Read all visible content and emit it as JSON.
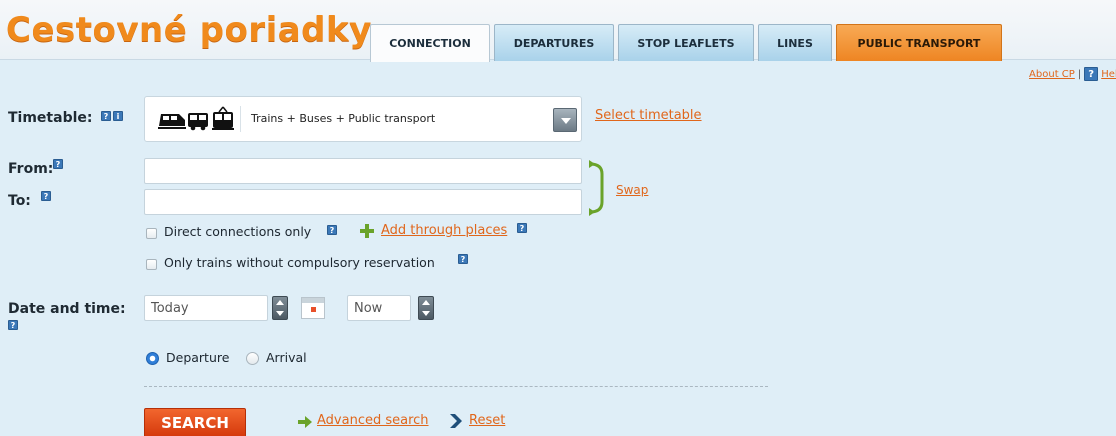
{
  "header": {
    "logo": "Cestovné poriadky",
    "tabs": [
      {
        "label": "CONNECTION",
        "state": "active"
      },
      {
        "label": "DEPARTURES",
        "state": "normal"
      },
      {
        "label": "STOP LEAFLETS",
        "state": "normal"
      },
      {
        "label": "LINES",
        "state": "normal"
      },
      {
        "label": "PUBLIC TRANSPORT",
        "state": "highlight"
      }
    ],
    "about_link": "About CP",
    "help_link": "Help"
  },
  "form": {
    "timetable": {
      "label": "Timetable:",
      "icons": [
        "train-icon",
        "bus-icon",
        "tram-icon"
      ],
      "value": "Trains + Buses + Public transport",
      "select_link": "Select timetable"
    },
    "from": {
      "label": "From:",
      "value": ""
    },
    "to": {
      "label": "To:",
      "value": ""
    },
    "swap_label": "Swap",
    "direct_connections_label": "Direct connections only",
    "add_through_places_label": "Add through places",
    "no_reservation_label": "Only trains without compulsory reservation",
    "datetime": {
      "label": "Date and time:",
      "date_value": "Today",
      "time_value": "Now"
    },
    "radio_departure": "Departure",
    "radio_arrival": "Arrival",
    "selected_mode": "Departure",
    "search_button": "SEARCH",
    "advanced_search": "Advanced search",
    "reset": "Reset"
  },
  "colors": {
    "background": "#dfeef7",
    "accent_orange": "#f08a1c",
    "link_orange": "#e0661b",
    "search_button": "#e04818",
    "help_blue": "#3b78b8"
  }
}
